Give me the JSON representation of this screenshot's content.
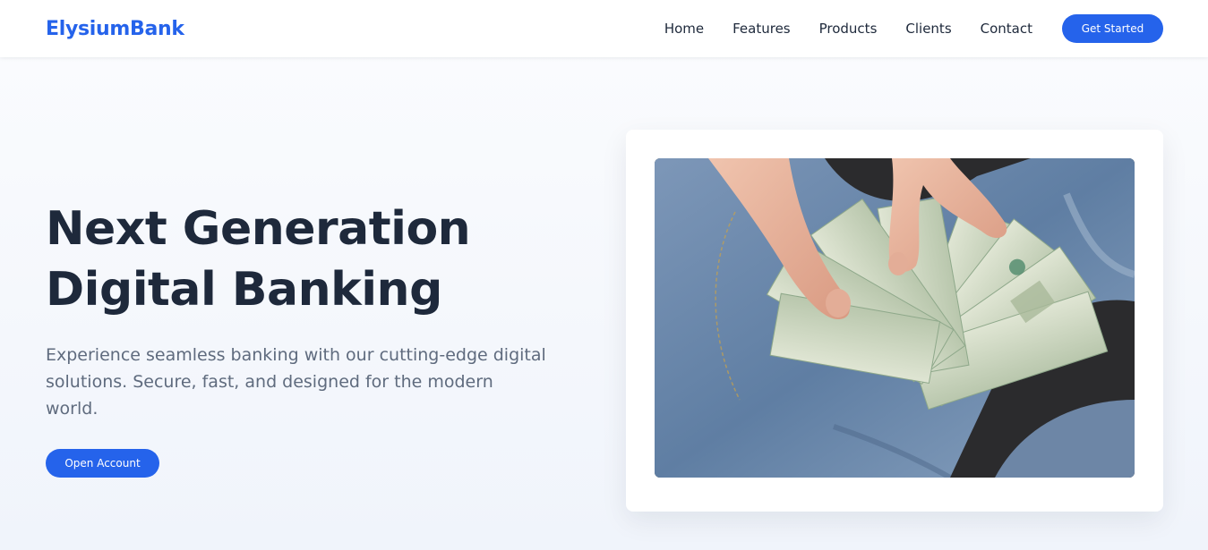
{
  "brand": {
    "name": "ElysiumBank",
    "color": "#2563eb"
  },
  "nav": {
    "links": [
      "Home",
      "Features",
      "Products",
      "Clients",
      "Contact"
    ],
    "cta_label": "Get Started"
  },
  "hero": {
    "title_line1": "Next Generation",
    "title_line2": "Digital Banking",
    "subtitle": "Experience seamless banking with our cutting-edge digital solutions. Secure, fast, and designed for the modern world.",
    "cta_label": "Open Account",
    "image_subject": "hands-fanning-hundred-dollar-bills"
  },
  "colors": {
    "accent": "#2563eb",
    "heading": "#1e293b",
    "muted": "#5f6b7e"
  }
}
